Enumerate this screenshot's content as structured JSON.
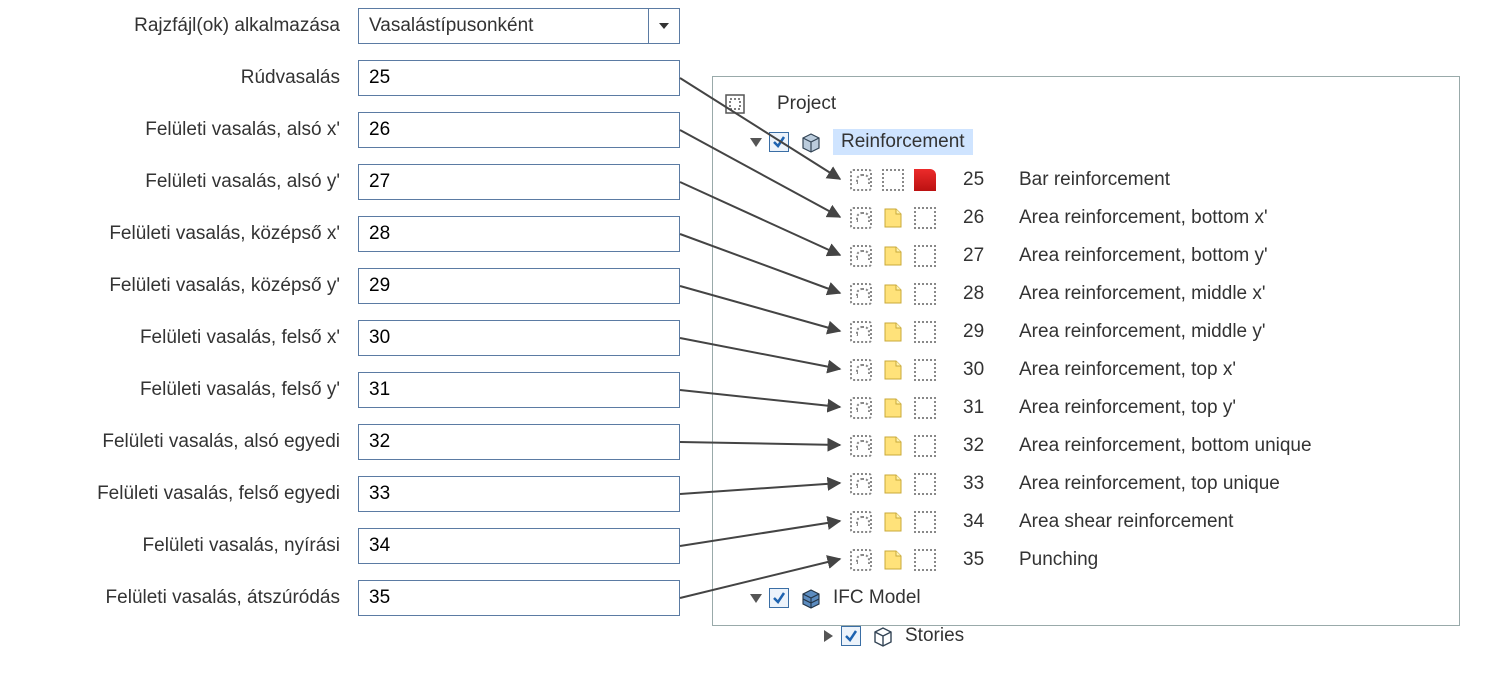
{
  "form": {
    "apply_label": "Rajzfájl(ok) alkalmazása",
    "apply_value": "Vasalástípusonként",
    "rows": [
      {
        "label": "Rúdvasalás",
        "value": "25"
      },
      {
        "label": "Felületi vasalás, alsó x'",
        "value": "26"
      },
      {
        "label": "Felületi vasalás, alsó y'",
        "value": "27"
      },
      {
        "label": "Felületi vasalás, középső x'",
        "value": "28"
      },
      {
        "label": "Felületi vasalás, középső y'",
        "value": "29"
      },
      {
        "label": "Felületi vasalás, felső x'",
        "value": "30"
      },
      {
        "label": "Felületi vasalás, felső y'",
        "value": "31"
      },
      {
        "label": "Felületi vasalás, alsó egyedi",
        "value": "32"
      },
      {
        "label": "Felületi vasalás, felső egyedi",
        "value": "33"
      },
      {
        "label": "Felületi vasalás, nyírási",
        "value": "34"
      },
      {
        "label": "Felületi vasalás, átszúródás",
        "value": "35"
      }
    ]
  },
  "tree": {
    "project": "Project",
    "reinforcement": "Reinforcement",
    "ifc_model": "IFC Model",
    "stories": "Stories",
    "layers": [
      {
        "num": "25",
        "name": "Bar reinforcement",
        "color": "red"
      },
      {
        "num": "26",
        "name": "Area reinforcement, bottom x'",
        "color": "yellow"
      },
      {
        "num": "27",
        "name": "Area reinforcement, bottom y'",
        "color": "yellow"
      },
      {
        "num": "28",
        "name": "Area reinforcement, middle x'",
        "color": "yellow"
      },
      {
        "num": "29",
        "name": "Area reinforcement, middle y'",
        "color": "yellow"
      },
      {
        "num": "30",
        "name": "Area reinforcement, top x'",
        "color": "yellow"
      },
      {
        "num": "31",
        "name": "Area reinforcement, top y'",
        "color": "yellow"
      },
      {
        "num": "32",
        "name": "Area reinforcement, bottom unique",
        "color": "yellow"
      },
      {
        "num": "33",
        "name": "Area reinforcement, top unique",
        "color": "yellow"
      },
      {
        "num": "34",
        "name": "Area shear reinforcement",
        "color": "yellow"
      },
      {
        "num": "35",
        "name": "Punching",
        "color": "yellow"
      }
    ]
  }
}
